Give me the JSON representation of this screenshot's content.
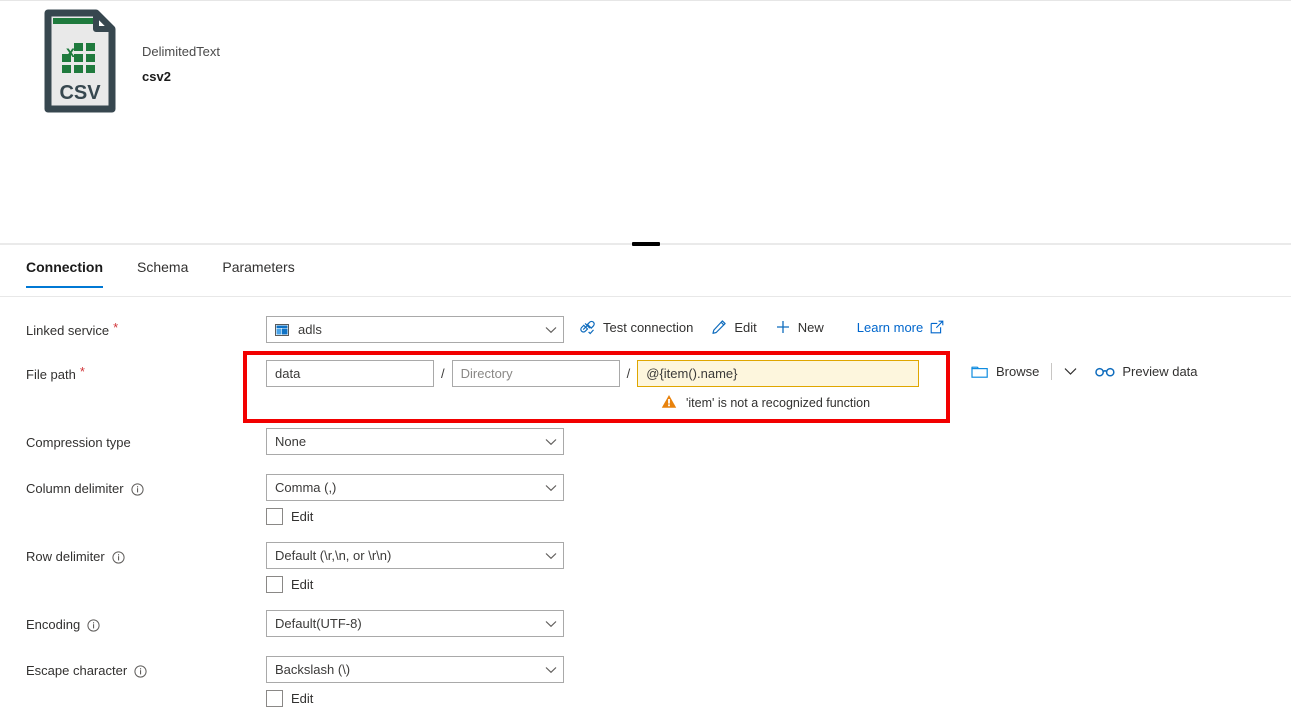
{
  "entity": {
    "type_label": "DelimitedText",
    "name": "csv2",
    "icon_label": "CSV",
    "icon_name": "csv-file-icon"
  },
  "tabs": [
    {
      "label": "Connection",
      "active": true
    },
    {
      "label": "Schema",
      "active": false
    },
    {
      "label": "Parameters",
      "active": false
    }
  ],
  "form": {
    "linked_service": {
      "label": "Linked service",
      "required": "*",
      "value": "adls",
      "actions": [
        {
          "label": "Test connection",
          "icon": "plug-check-icon",
          "style": "default"
        },
        {
          "label": "Edit",
          "icon": "pencil-icon",
          "style": "default"
        },
        {
          "label": "New",
          "icon": "plus-icon",
          "style": "default"
        },
        {
          "label": "Learn more",
          "icon": "external-link-icon",
          "style": "link"
        }
      ]
    },
    "file_path": {
      "label": "File path",
      "required": "*",
      "container_value": "data",
      "directory_placeholder": "Directory",
      "directory_value": "",
      "file_value": "@{item().name}",
      "separator": "/",
      "warning": "'item' is not a recognized function",
      "warning_icon": "warning-triangle-icon",
      "browse_label": "Browse",
      "browse_icon": "folder-icon",
      "browse_chevron_icon": "chevron-down-icon",
      "preview_label": "Preview data",
      "preview_icon": "glasses-icon"
    },
    "compression_type": {
      "label": "Compression type",
      "value": "None"
    },
    "column_delimiter": {
      "label": "Column delimiter",
      "info_icon": "info-icon",
      "value": "Comma (,)",
      "edit_label": "Edit",
      "edit_checked": false
    },
    "row_delimiter": {
      "label": "Row delimiter",
      "info_icon": "info-icon",
      "value": "Default (\\r,\\n, or \\r\\n)",
      "edit_label": "Edit",
      "edit_checked": false
    },
    "encoding": {
      "label": "Encoding",
      "info_icon": "info-icon",
      "value": "Default(UTF-8)"
    },
    "escape_character": {
      "label": "Escape character",
      "info_icon": "info-icon",
      "value": "Backslash (\\)",
      "edit_label": "Edit",
      "edit_checked": false
    }
  },
  "colors": {
    "accent": "#0078d4",
    "link": "#0066cc",
    "required": "#d13438",
    "annotation": "#f20000",
    "warning_field_bg": "#fdf6dd",
    "warning_field_border": "#dfa600",
    "warning_icon": "#e8820c",
    "icon_green": "#1f7a3d",
    "icon_dark": "#37474f"
  }
}
